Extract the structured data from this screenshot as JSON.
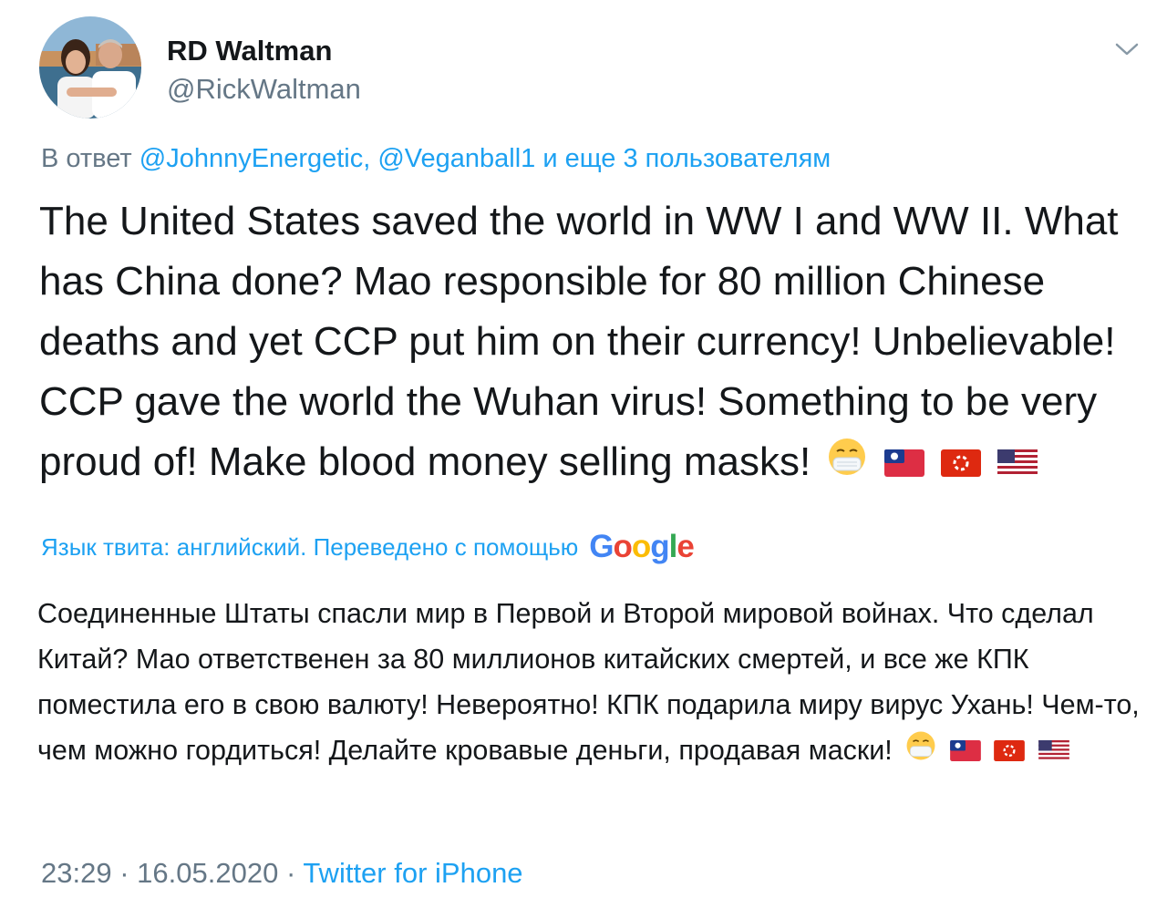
{
  "author": {
    "name": "RD Waltman",
    "handle": "@RickWaltman"
  },
  "reply_context": {
    "prefix": "В ответ",
    "mentions": "@JohnnyEnergetic, @Veganball1",
    "suffix": "и еще 3 пользователям"
  },
  "tweet": {
    "text": "The United States saved the world in WW I and WW II. What has China done? Mao responsible for 80 million Chinese deaths and yet CCP put him on their currency! Unbelievable! CCP gave the world the Wuhan virus! Something to be very proud of! Make blood money selling masks!",
    "emojis": [
      "mask-face",
      "taiwan-flag",
      "hong-kong-flag",
      "us-flag"
    ]
  },
  "translation": {
    "label": "Язык твита: английский. Переведено с помощью",
    "provider": "Google",
    "text": "Соединенные Штаты спасли мир в Первой и Второй мировой войнах. Что сделал Китай? Мао ответственен за 80 миллионов китайских смертей, и все же КПК поместила его в свою валюту! Невероятно! КПК подарила миру вирус Ухань! Чем-то, чем можно гордиться! Делайте кровавые деньги, продавая маски!"
  },
  "meta": {
    "time": "23:29",
    "separator1": "·",
    "date": "16.05.2020",
    "separator2": "·",
    "source": "Twitter for iPhone"
  },
  "colors": {
    "link": "#1da1f2",
    "secondary_text": "#657786",
    "primary_text": "#14171a"
  }
}
